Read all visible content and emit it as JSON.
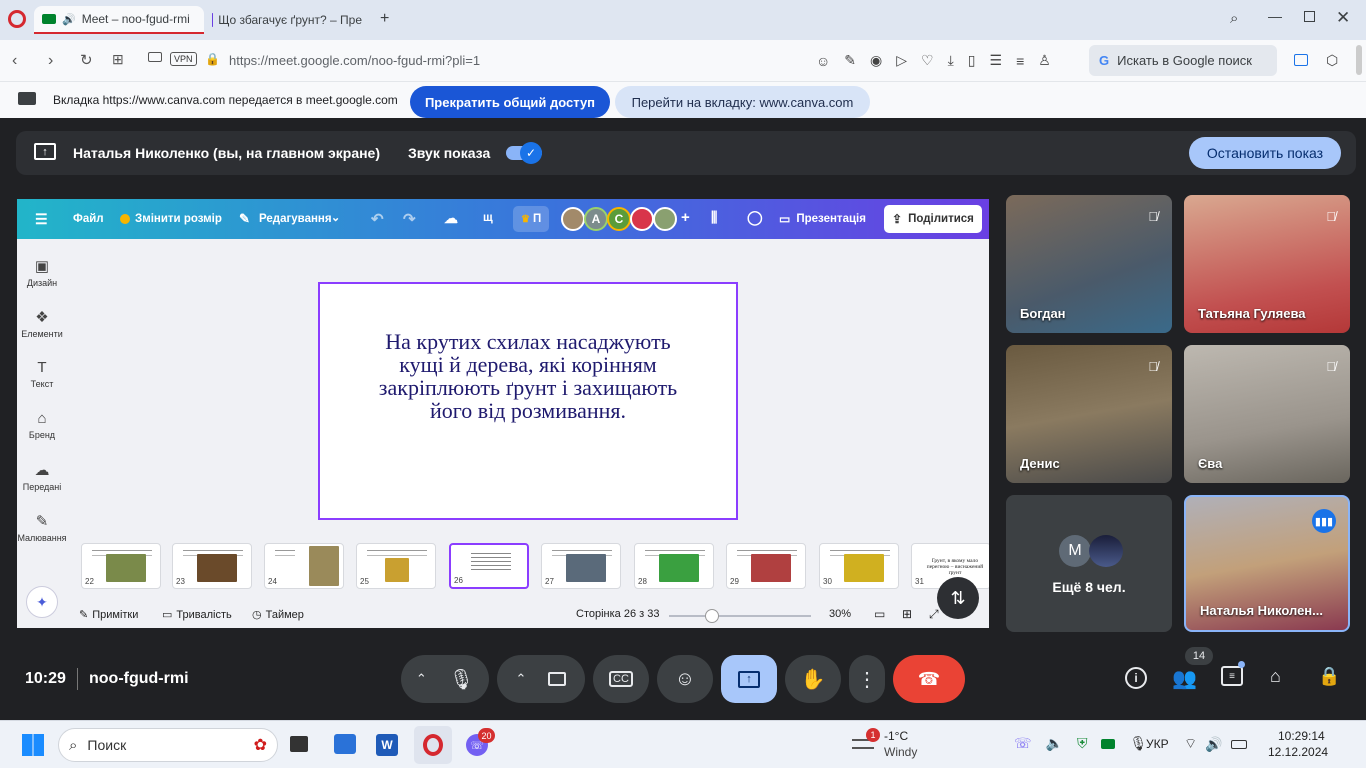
{
  "browser": {
    "tabs": [
      {
        "title": "Meet – noo-fgud-rmi"
      },
      {
        "title": "Що збагачує ґрунт? – Пре"
      }
    ],
    "url": "https://meet.google.com/noo-fgud-rmi?pli=1",
    "vpn_label": "VPN",
    "search_label": "Искать в Google поиск"
  },
  "share_bar": {
    "message": "Вкладка https://www.canva.com передается в meet.google.com",
    "stop_label": "Прекратить общий доступ",
    "goto_label": "Перейти на вкладку: www.canva.com"
  },
  "present_banner": {
    "presenter": "Наталья Николенко (вы, на главном экране)",
    "audio_label": "Звук показа",
    "stop_label": "Остановить показ"
  },
  "canva": {
    "menu": {
      "file": "Файл",
      "resize": "Змінити розмір",
      "editing": "Редагування",
      "shortcut": "щ",
      "crown_label": "П",
      "present": "Презентація",
      "share": "Поділитися"
    },
    "collaborators": [
      "A",
      "C"
    ],
    "side": [
      {
        "label": "Дизайн",
        "icon": "design-icon"
      },
      {
        "label": "Елементи",
        "icon": "elements-icon"
      },
      {
        "label": "Текст",
        "icon": "text-icon"
      },
      {
        "label": "Бренд",
        "icon": "brand-icon"
      },
      {
        "label": "Передані",
        "icon": "uploads-icon"
      },
      {
        "label": "Малювання",
        "icon": "draw-icon"
      }
    ],
    "slide_text": "На крутих схилах насаджують кущі й дерева, які корінням закріплюють ґрунт і захищають його від розмивання.",
    "thumbnails": [
      "22",
      "23",
      "24",
      "25",
      "26",
      "27",
      "28",
      "29",
      "30",
      "31"
    ],
    "thumb31_text": "Ґрунт, в якому мало перегною – виснажений ґрунт",
    "bottom": {
      "notes": "Примітки",
      "duration": "Тривалість",
      "timer": "Таймер",
      "page": "Сторінка 26 з 33",
      "zoom": "30%"
    }
  },
  "participants": [
    {
      "name": "Богдан",
      "muted": true
    },
    {
      "name": "Татьяна Гуляева",
      "muted": true
    },
    {
      "name": "Денис",
      "muted": true
    },
    {
      "name": "Єва",
      "muted": true
    },
    {
      "name": "Ещё 8 чел.",
      "initial": "M"
    },
    {
      "name": "Наталья Николен...",
      "speaking": true
    }
  ],
  "meeting": {
    "time": "10:29",
    "code": "noo-fgud-rmi",
    "people_count": "14"
  },
  "taskbar": {
    "search_placeholder": "Поиск",
    "viber_badge": "20",
    "weather_temp": "-1°C",
    "weather_desc": "Windy",
    "weather_badge": "1",
    "lang": "УКР",
    "clock_time": "10:29:14",
    "clock_date": "12.12.2024"
  },
  "colors": {
    "accent_blue": "#1a56d6",
    "meet_bg": "#202124",
    "end_call_red": "#ea4335",
    "canva_purple": "#8b3dff"
  }
}
